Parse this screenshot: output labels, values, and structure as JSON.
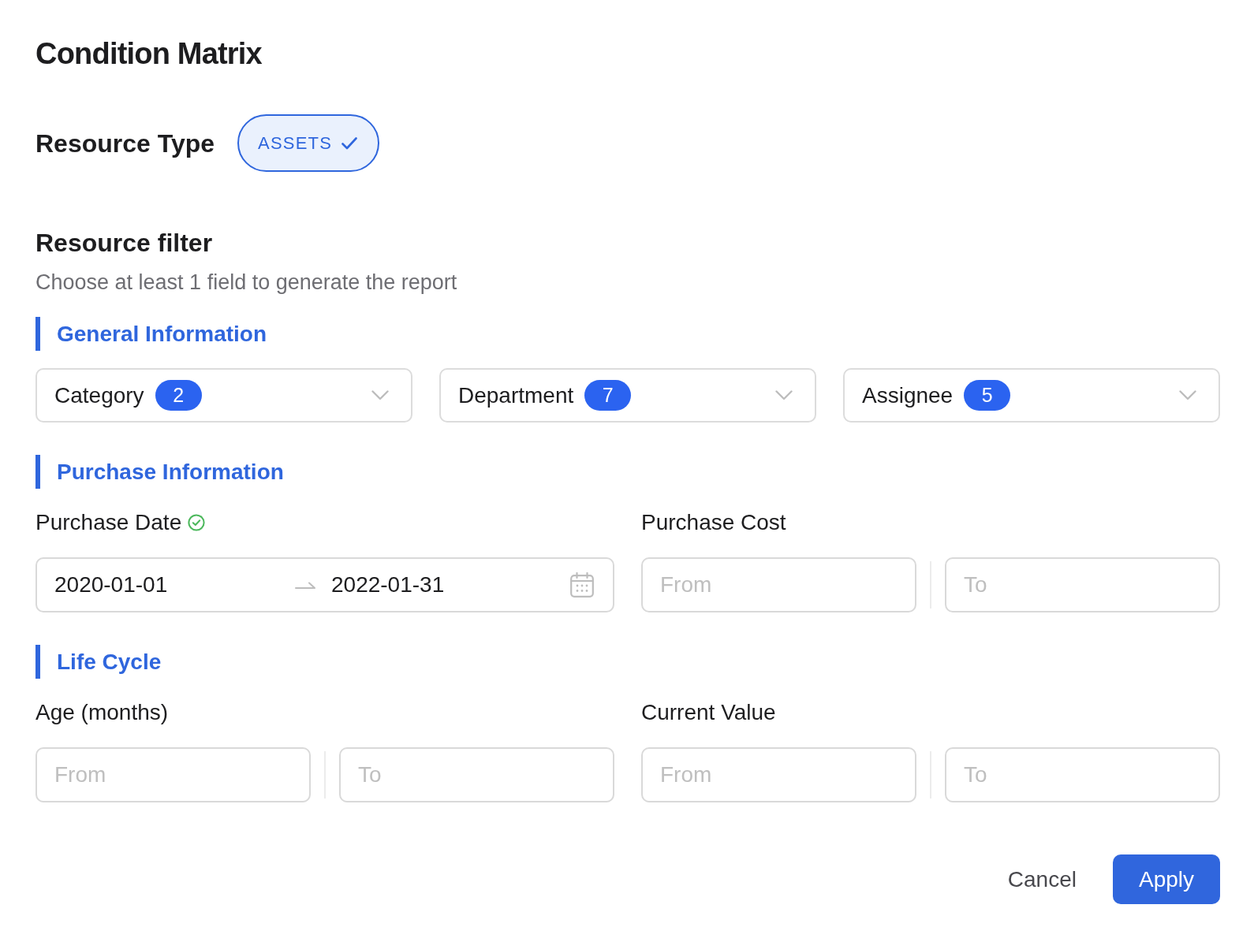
{
  "title": "Condition Matrix",
  "resource_type": {
    "label": "Resource Type",
    "options": [
      {
        "label": "ASSETS",
        "selected": true
      }
    ]
  },
  "resource_filter": {
    "title": "Resource filter",
    "hint": "Choose at least 1 field to generate the report",
    "sections": [
      {
        "title": "General Information",
        "kind": "dropdowns",
        "dropdowns": [
          {
            "label": "Category",
            "count": "2"
          },
          {
            "label": "Department",
            "count": "7"
          },
          {
            "label": "Assignee",
            "count": "5"
          }
        ]
      },
      {
        "title": "Purchase Information",
        "kind": "fields",
        "fields": [
          {
            "label": "Purchase Date",
            "kind": "date_range",
            "complete": true,
            "start": "2020-01-01",
            "end": "2022-01-31"
          },
          {
            "label": "Purchase Cost",
            "kind": "number_range",
            "complete": false,
            "from": {
              "placeholder": "From"
            },
            "to": {
              "placeholder": "To"
            }
          }
        ]
      },
      {
        "title": "Life Cycle",
        "kind": "fields",
        "fields": [
          {
            "label": "Age (months)",
            "kind": "number_range",
            "complete": false,
            "from": {
              "placeholder": "From"
            },
            "to": {
              "placeholder": "To"
            }
          },
          {
            "label": "Current Value",
            "kind": "number_range",
            "complete": false,
            "from": {
              "placeholder": "From"
            },
            "to": {
              "placeholder": "To"
            }
          }
        ]
      }
    ]
  },
  "buttons": [
    {
      "label": "Cancel",
      "kind": "text"
    },
    {
      "label": "Apply",
      "kind": "primary"
    }
  ]
}
